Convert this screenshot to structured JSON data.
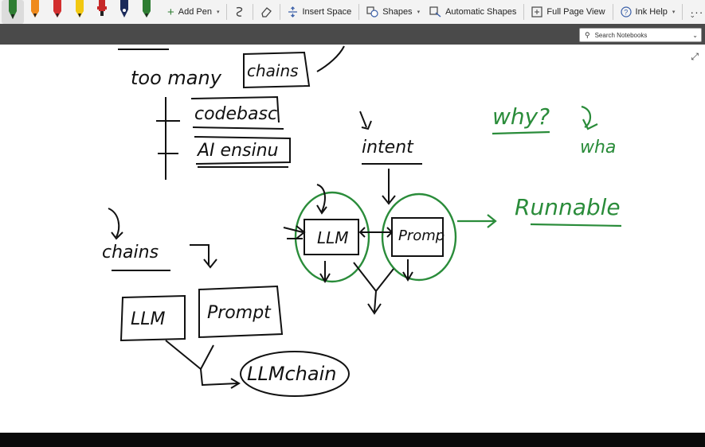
{
  "toolbar": {
    "add_pen": "Add Pen",
    "insert_space": "Insert Space",
    "shapes": "Shapes",
    "automatic_shapes": "Automatic Shapes",
    "full_page_view": "Full Page View",
    "ink_help": "Ink Help",
    "more": "···"
  },
  "pens": [
    {
      "name": "green-pen",
      "color": "#2e7d32"
    },
    {
      "name": "orange-pen",
      "color": "#ef8a1c"
    },
    {
      "name": "red-pen",
      "color": "#d32f2f"
    },
    {
      "name": "yellow-pen",
      "color": "#f2c811"
    },
    {
      "name": "red-marker",
      "color": "#c62828"
    },
    {
      "name": "navy-pen",
      "color": "#1a2a5a"
    },
    {
      "name": "green-pen-2",
      "color": "#2e7d32"
    }
  ],
  "search": {
    "placeholder": "Search Notebooks"
  },
  "ink": {
    "too_many": "too many",
    "chains_top": "chains",
    "codebase": "codebasc",
    "ai_engineer": "AI ensinu",
    "intent": "intent",
    "why": "why?",
    "wha": "wha",
    "runnable": "Runnable",
    "llm_box": "LLM",
    "prompt_box": "Promp",
    "chains_mid": "chains",
    "llm_left": "LLM",
    "prompt_left": "Prompt",
    "llmchain": "LLMchain"
  },
  "colors": {
    "ink_black": "#111111",
    "ink_green": "#2a8c3a"
  }
}
